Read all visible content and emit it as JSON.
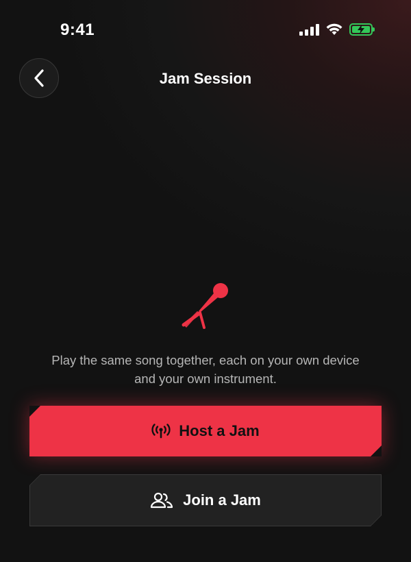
{
  "status_bar": {
    "time": "9:41",
    "icons": [
      "cellular-signal-icon",
      "wifi-icon",
      "battery-charging-icon"
    ],
    "battery_color": "#34c759"
  },
  "header": {
    "back_icon": "chevron-left-icon",
    "title": "Jam Session"
  },
  "hero": {
    "icon": "microphone-icon",
    "icon_color": "#ee3346",
    "description_line1": "Play the same song together, each on your own device",
    "description_line2": "and your own instrument."
  },
  "actions": {
    "host": {
      "label": "Host a Jam",
      "icon": "broadcast-icon",
      "color": "#ee3346"
    },
    "join": {
      "label": "Join a Jam",
      "icon": "people-icon",
      "color": "#222222"
    }
  }
}
